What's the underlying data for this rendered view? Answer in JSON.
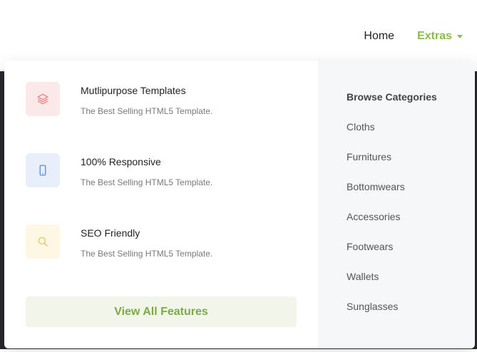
{
  "nav": {
    "home_label": "Home",
    "extras_label": "Extras"
  },
  "colors": {
    "accent": "#8bbc4f",
    "icon_red": "#e8878a",
    "icon_blue": "#5b8fd0",
    "icon_yellow": "#e8c45a"
  },
  "features": [
    {
      "icon": "layers-icon",
      "title": "Mutlipurpose Templates",
      "description": "The Best Selling HTML5 Template."
    },
    {
      "icon": "mobile-phone-icon",
      "title": "100% Responsive",
      "description": "The Best Selling HTML5 Template."
    },
    {
      "icon": "search-icon",
      "title": "SEO Friendly",
      "description": "The Best Selling HTML5 Template."
    }
  ],
  "cta": {
    "label": "View All Features"
  },
  "categories": {
    "heading": "Browse Categories",
    "items": [
      "Cloths",
      "Furnitures",
      "Bottomwears",
      "Accessories",
      "Footwears",
      "Wallets",
      "Sunglasses"
    ]
  }
}
